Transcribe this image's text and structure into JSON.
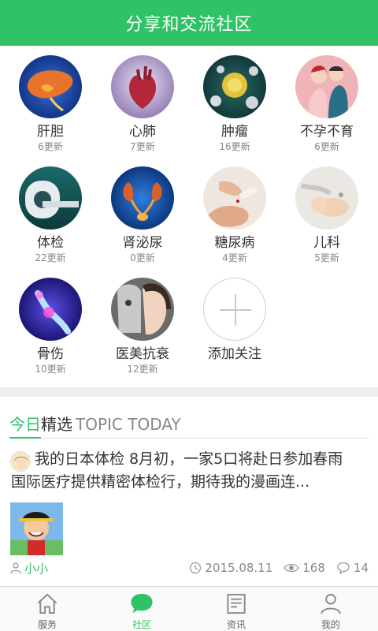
{
  "header": {
    "title": "分享和交流社区"
  },
  "categories": [
    {
      "name": "肝胆",
      "count": "6更新"
    },
    {
      "name": "心肺",
      "count": "7更新"
    },
    {
      "name": "肿瘤",
      "count": "16更新"
    },
    {
      "name": "不孕不育",
      "count": "6更新"
    },
    {
      "name": "体检",
      "count": "22更新"
    },
    {
      "name": "肾泌尿",
      "count": "0更新"
    },
    {
      "name": "糖尿病",
      "count": "4更新"
    },
    {
      "name": "儿科",
      "count": "5更新"
    },
    {
      "name": "骨伤",
      "count": "10更新"
    },
    {
      "name": "医美抗衰",
      "count": "12更新"
    }
  ],
  "add": {
    "label": "添加关注"
  },
  "topic": {
    "title_a": "今日",
    "title_b": "精选",
    "title_en": "TOPIC TODAY",
    "post": {
      "title_line1": "我的日本体检 8月初，一家5口将赴日参加春雨",
      "title_line2": "国际医疗提供精密体检行，期待我的漫画连...",
      "user": "小小",
      "date": "2015.08.11",
      "views": "168",
      "comments": "14"
    }
  },
  "tabs": [
    {
      "label": "服务",
      "icon": "home-icon"
    },
    {
      "label": "社区",
      "icon": "chat-bubble-icon"
    },
    {
      "label": "资讯",
      "icon": "news-icon"
    },
    {
      "label": "我的",
      "icon": "person-icon"
    }
  ],
  "colors": {
    "brand_green": "#2fc266",
    "separator": "#eeeeee",
    "text": "#333333",
    "muted": "#888888"
  }
}
